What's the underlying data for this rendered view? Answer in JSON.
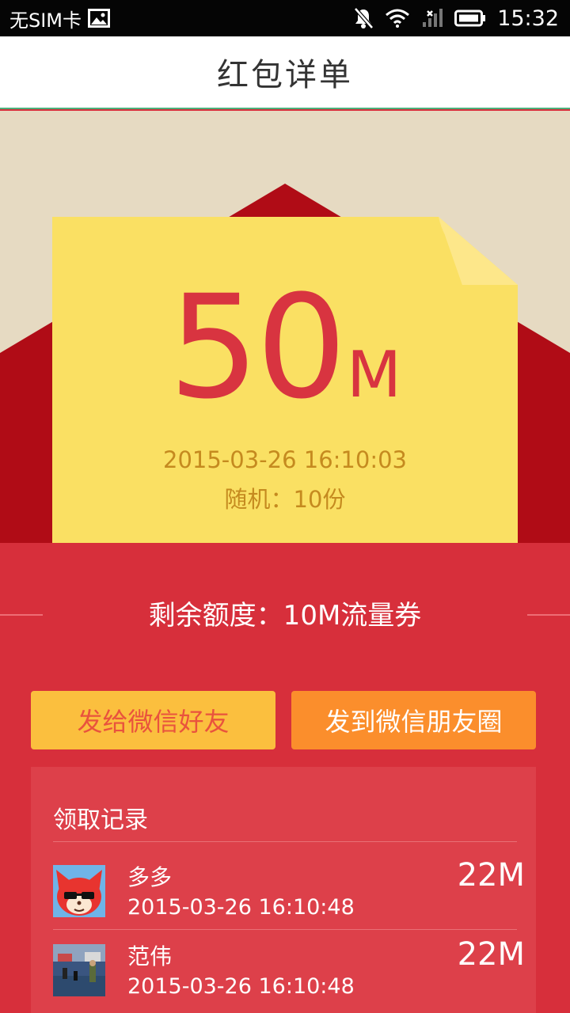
{
  "status_bar": {
    "carrier": "无SIM卡",
    "time": "15:32",
    "icons": [
      "image-icon",
      "notifications-off-icon",
      "wifi-icon",
      "no-signal-icon",
      "battery-icon"
    ]
  },
  "header": {
    "title": "红包详单"
  },
  "packet": {
    "amount": "50",
    "unit": "M",
    "date": "2015-03-26 16:10:03",
    "share_info": "随机：10份"
  },
  "remaining": {
    "text": "剩余额度：10M流量券"
  },
  "actions": {
    "send_friend": "发给微信好友",
    "send_moments": "发到微信朋友圈"
  },
  "records": {
    "title": "领取记录",
    "items": [
      {
        "name": "多多",
        "time": "2015-03-26 16:10:48",
        "amount": "22M",
        "avatar": "fox-avatar"
      },
      {
        "name": "范伟",
        "time": "2015-03-26 16:10:48",
        "amount": "22M",
        "avatar": "photo-avatar"
      }
    ]
  },
  "colors": {
    "envelope_red": "#d72f3b",
    "envelope_dark": "#b00c16",
    "card_yellow": "#fae063",
    "amount_red": "#d83440",
    "date_gold": "#c58a1f",
    "button_yellow": "#fbbf3e",
    "button_orange": "#fb8e2c"
  }
}
